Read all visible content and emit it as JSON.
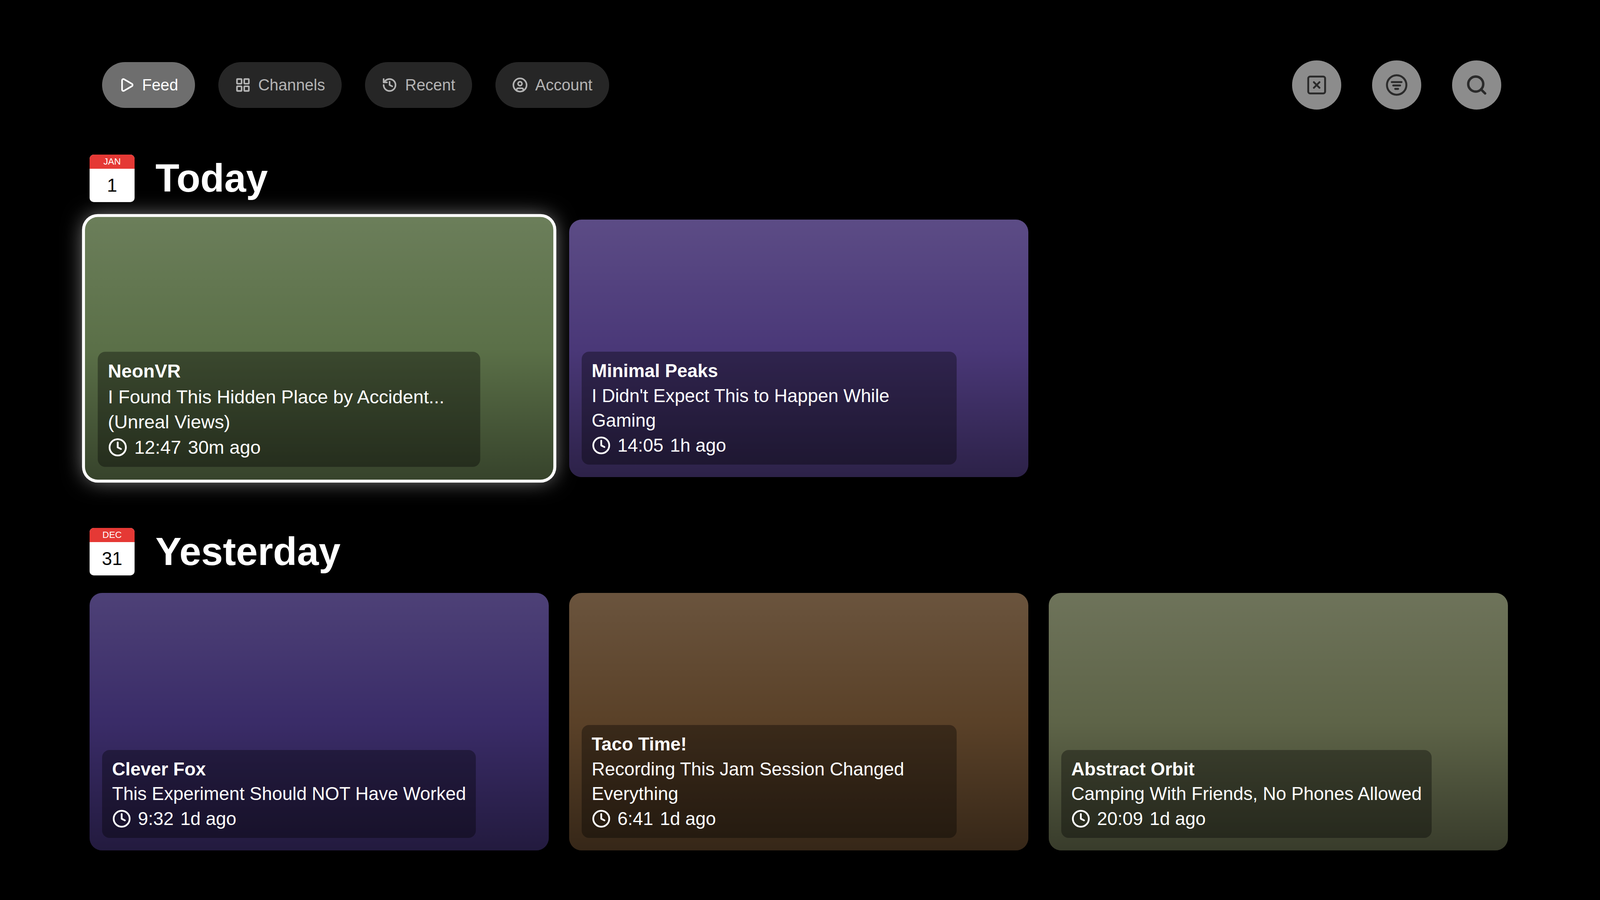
{
  "nav": {
    "tabs": [
      {
        "label": "Feed",
        "selected": true
      },
      {
        "label": "Channels",
        "selected": false
      },
      {
        "label": "Recent",
        "selected": false
      },
      {
        "label": "Account",
        "selected": false
      }
    ]
  },
  "sections": [
    {
      "title": "Today",
      "calendar": {
        "month": "JAN",
        "day": "1"
      },
      "videos": [
        {
          "channel": "NeonVR",
          "title": "I Found This Hidden Place by Accident... (Unreal Views)",
          "duration": "12:47",
          "age": "30m ago",
          "selected": true,
          "color": "#5b7048"
        },
        {
          "channel": "Minimal Peaks",
          "title": "I Didn't Expect This to Happen While Gaming",
          "duration": "14:05",
          "age": "1h ago",
          "selected": false,
          "color": "#4a3878"
        }
      ]
    },
    {
      "title": "Yesterday",
      "calendar": {
        "month": "DEC",
        "day": "31"
      },
      "videos": [
        {
          "channel": "Clever Fox",
          "title": "This Experiment Should NOT Have Worked",
          "duration": "9:32",
          "age": "1d ago",
          "selected": false,
          "color": "#3a2c68"
        },
        {
          "channel": "Taco Time!",
          "title": "Recording This Jam Session Changed Everything",
          "duration": "6:41",
          "age": "1d ago",
          "selected": false,
          "color": "#5a4128"
        },
        {
          "channel": "Abstract Orbit",
          "title": "Camping With Friends, No Phones Allowed",
          "duration": "20:09",
          "age": "1d ago",
          "selected": false,
          "color": "#5e6448"
        }
      ]
    }
  ]
}
